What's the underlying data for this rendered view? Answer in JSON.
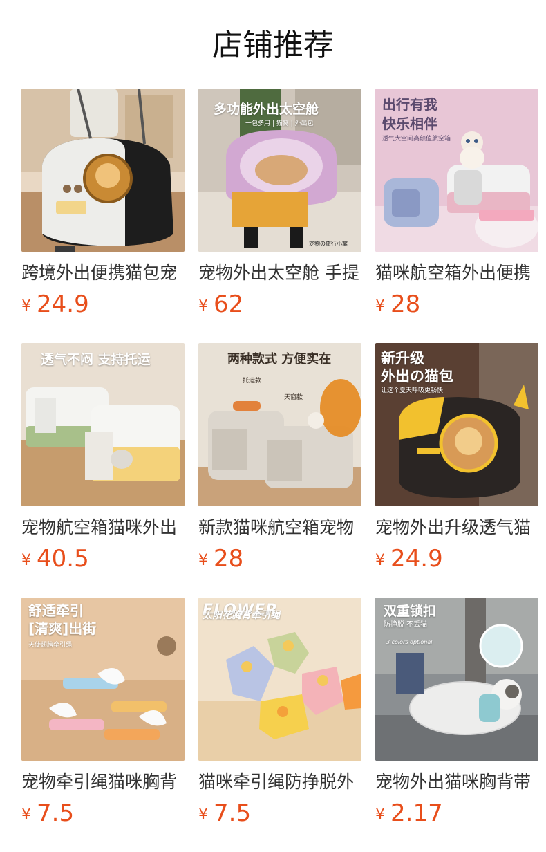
{
  "header": {
    "title": "店铺推荐"
  },
  "currency_symbol": "¥",
  "products": [
    {
      "name": "跨境外出便携猫包宠",
      "price": "24.9",
      "image_text": []
    },
    {
      "name": "宠物外出太空舱 手提",
      "price": "62",
      "image_text": [
        "多功能外出太空舱",
        "一包多用 | 猫窝 | 外出包",
        "宠物の旅行小窝"
      ]
    },
    {
      "name": "猫咪航空箱外出便携",
      "price": "28",
      "image_text": [
        "出行有我",
        "快乐相伴",
        "透气大空间高颜值航空箱"
      ]
    },
    {
      "name": "宠物航空箱猫咪外出",
      "price": "40.5",
      "image_text": [
        "透气不闷 支持托运"
      ]
    },
    {
      "name": "新款猫咪航空箱宠物",
      "price": "28",
      "image_text": [
        "两种款式 方便实在",
        "托运款",
        "天窗款"
      ]
    },
    {
      "name": "宠物外出升级透气猫",
      "price": "24.9",
      "image_text": [
        "新升级",
        "外出の猫包",
        "让这个夏天呼吸更畅快"
      ]
    },
    {
      "name": "宠物牵引绳猫咪胸背",
      "price": "7.5",
      "image_text": [
        "舒适牵引",
        "[清爽]出街",
        "天使翅膀牵引绳"
      ]
    },
    {
      "name": "猫咪牵引绳防挣脱外",
      "price": "7.5",
      "image_text": [
        "FLOWER",
        "太阳花胸背牵引绳"
      ]
    },
    {
      "name": "宠物外出猫咪胸背带",
      "price": "2.17",
      "image_text": [
        "双重锁扣",
        "防挣脱 不丢猫",
        "3 colors optional"
      ]
    }
  ],
  "colors": {
    "price": "#e84e1b",
    "title": "#111111",
    "name": "#333333"
  }
}
